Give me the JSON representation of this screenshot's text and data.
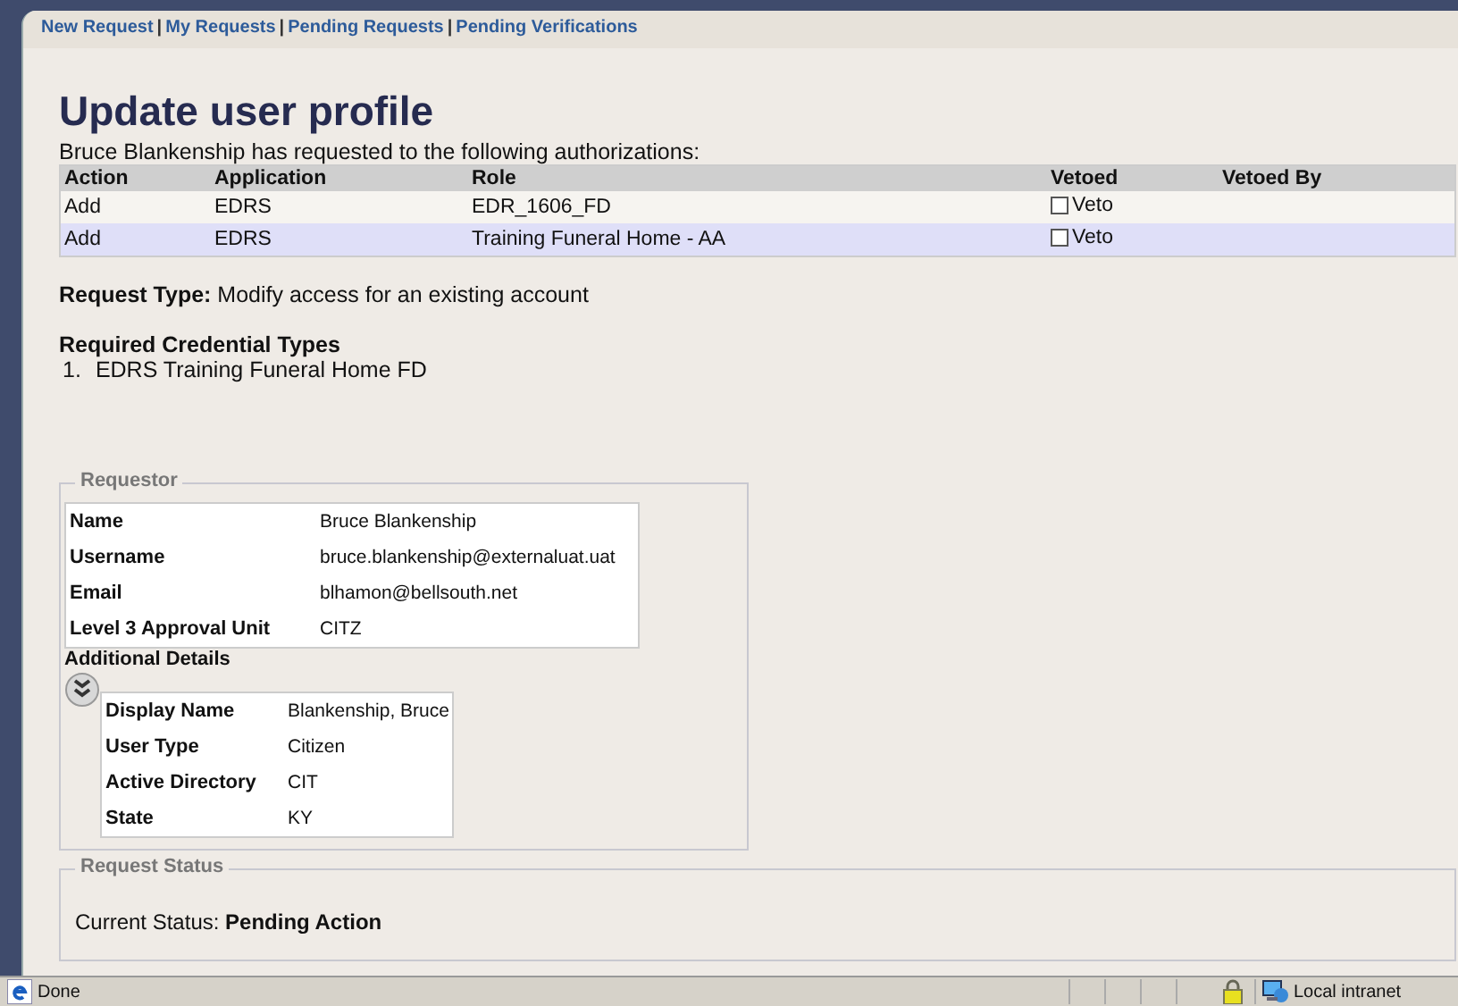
{
  "nav": {
    "separator": "|",
    "links": [
      "New Request",
      "My Requests",
      "Pending Requests",
      "Pending Verifications"
    ]
  },
  "title": "Update user profile",
  "intro": "Bruce Blankenship has requested to the following authorizations:",
  "table": {
    "columns": [
      "Action",
      "Application",
      "Role",
      "Vetoed",
      "Vetoed By"
    ],
    "rows": [
      {
        "action": "Add",
        "application": "EDRS",
        "role": "EDR_1606_FD",
        "veto_label": "Veto",
        "checked": false
      },
      {
        "action": "Add",
        "application": "EDRS",
        "role": "Training Funeral Home - AA",
        "veto_label": "Veto",
        "checked": false
      }
    ]
  },
  "request_type": {
    "label": "Request Type:",
    "value": "Modify access for an existing account"
  },
  "credentials": {
    "heading": "Required Credential Types",
    "items": [
      {
        "number": "1.",
        "text": "EDRS Training Funeral Home FD"
      }
    ]
  },
  "requestor": {
    "legend": "Requestor",
    "fields": [
      {
        "label": "Name",
        "value": "Bruce Blankenship"
      },
      {
        "label": "Username",
        "value": "bruce.blankenship@externaluat.uat"
      },
      {
        "label": "Email",
        "value": "blhamon@bellsouth.net"
      },
      {
        "label": "Level 3 Approval Unit",
        "value": "CITZ"
      }
    ],
    "additional_heading": "Additional Details",
    "expanded": true,
    "additional": [
      {
        "label": "Display Name",
        "value": "Blankenship, Bruce"
      },
      {
        "label": "User Type",
        "value": "Citizen"
      },
      {
        "label": "Active Directory",
        "value": "CIT"
      },
      {
        "label": "State",
        "value": "KY"
      }
    ]
  },
  "request_status": {
    "legend": "Request Status",
    "label": "Current Status:",
    "value": "Pending Action"
  },
  "status_bar": {
    "text": "Done",
    "zone": "Local intranet"
  }
}
